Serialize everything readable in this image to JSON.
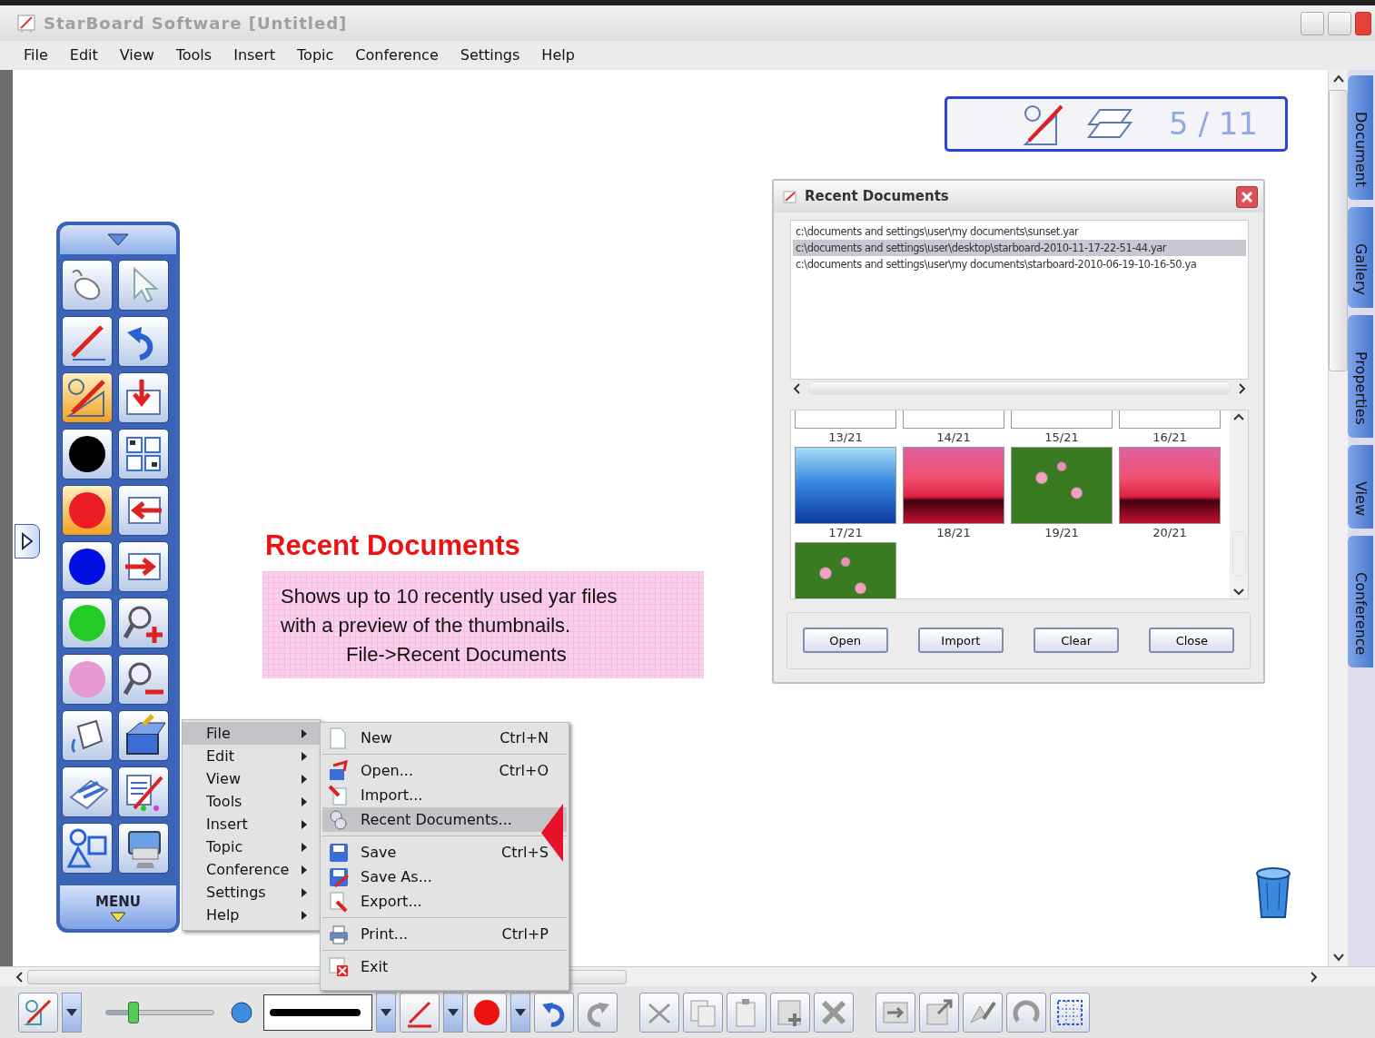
{
  "window": {
    "title": "StarBoard Software [Untitled]"
  },
  "menu_bar": [
    "File",
    "Edit",
    "View",
    "Tools",
    "Insert",
    "Topic",
    "Conference",
    "Settings",
    "Help"
  ],
  "page_counter": {
    "text": "5 / 11"
  },
  "side_tabs": [
    "Document",
    "Gallery",
    "Properties",
    "View",
    "Conference"
  ],
  "tool_palette": {
    "menu_label": "MENU",
    "items": [
      {
        "kind": "tool",
        "selected": false
      },
      {
        "kind": "tool",
        "selected": false
      },
      {
        "kind": "tool",
        "selected": false
      },
      {
        "kind": "tool",
        "selected": false
      },
      {
        "kind": "tool",
        "selected": true
      },
      {
        "kind": "tool",
        "selected": false
      },
      {
        "kind": "color",
        "color": "#000000",
        "selected": false
      },
      {
        "kind": "tool",
        "selected": false
      },
      {
        "kind": "color",
        "color": "#ee1c24",
        "selected": true
      },
      {
        "kind": "tool",
        "selected": false
      },
      {
        "kind": "color",
        "color": "#0010e0",
        "selected": false
      },
      {
        "kind": "tool",
        "selected": false
      },
      {
        "kind": "color",
        "color": "#22cc22",
        "selected": false
      },
      {
        "kind": "tool",
        "selected": false
      },
      {
        "kind": "color",
        "color": "#e898d0",
        "selected": false
      },
      {
        "kind": "tool",
        "selected": false
      },
      {
        "kind": "tool",
        "selected": false
      },
      {
        "kind": "tool",
        "selected": false
      },
      {
        "kind": "tool",
        "selected": false
      },
      {
        "kind": "tool",
        "selected": false
      },
      {
        "kind": "tool",
        "selected": false
      },
      {
        "kind": "tool",
        "selected": false
      }
    ]
  },
  "annotation": {
    "title": "Recent Documents",
    "lines": [
      "Shows up to 10 recently used yar files",
      "with a preview of the thumbnails.",
      "File->Recent Documents"
    ]
  },
  "recent_documents_dialog": {
    "title": "Recent Documents",
    "files": [
      {
        "path": "c:\\documents and settings\\user\\my documents\\sunset.yar",
        "selected": false
      },
      {
        "path": "c:\\documents and settings\\user\\desktop\\starboard-2010-11-17-22-51-44.yar",
        "selected": true
      },
      {
        "path": "c:\\documents and settings\\user\\my documents\\starboard-2010-06-19-10-16-50.ya",
        "selected": false
      }
    ],
    "thumbnails": [
      {
        "label": "13/21",
        "kind": "blank"
      },
      {
        "label": "14/21",
        "kind": "blank"
      },
      {
        "label": "15/21",
        "kind": "blank"
      },
      {
        "label": "16/21",
        "kind": "blank"
      },
      {
        "label": "17/21",
        "kind": "ocean"
      },
      {
        "label": "18/21",
        "kind": "sunset"
      },
      {
        "label": "19/21",
        "kind": "flowers"
      },
      {
        "label": "20/21",
        "kind": "sunset"
      },
      {
        "kind": "flowers"
      }
    ],
    "buttons": [
      "Open",
      "Import",
      "Clear",
      "Close"
    ]
  },
  "context_menu": [
    {
      "label": "File",
      "selected": true
    },
    {
      "label": "Edit",
      "selected": false
    },
    {
      "label": "View",
      "selected": false
    },
    {
      "label": "Tools",
      "selected": false
    },
    {
      "label": "Insert",
      "selected": false
    },
    {
      "label": "Topic",
      "selected": false
    },
    {
      "label": "Conference",
      "selected": false
    },
    {
      "label": "Settings",
      "selected": false
    },
    {
      "label": "Help",
      "selected": false
    }
  ],
  "file_submenu": [
    [
      {
        "label": "New",
        "shortcut": "Ctrl+N",
        "selected": false
      }
    ],
    [
      {
        "label": "Open...",
        "shortcut": "Ctrl+O",
        "selected": false
      },
      {
        "label": "Import...",
        "selected": false
      },
      {
        "label": "Recent Documents...",
        "selected": true
      }
    ],
    [
      {
        "label": "Save",
        "shortcut": "Ctrl+S",
        "selected": false
      },
      {
        "label": "Save As...",
        "selected": false
      },
      {
        "label": "Export...",
        "selected": false
      }
    ],
    [
      {
        "label": "Print...",
        "shortcut": "Ctrl+P",
        "selected": false
      }
    ],
    [
      {
        "label": "Exit",
        "selected": false
      }
    ]
  ],
  "bottom_toolbar": {
    "thickness_slider": {
      "level": 0.25
    }
  }
}
